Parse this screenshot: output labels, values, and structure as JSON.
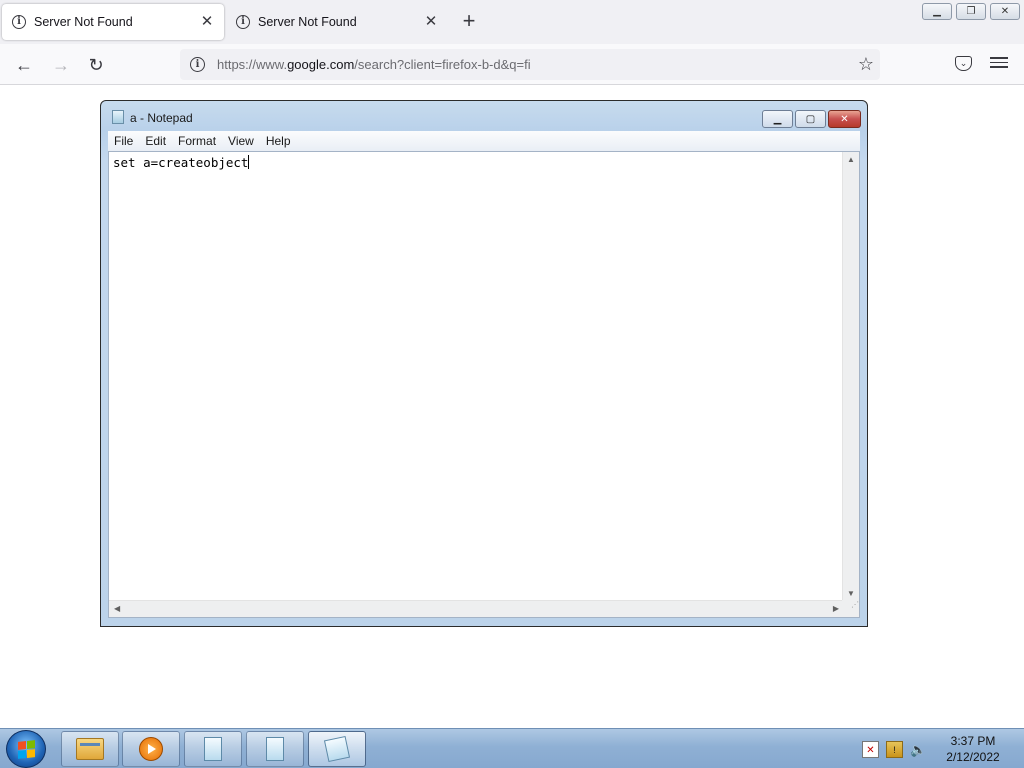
{
  "browser": {
    "tabs": [
      {
        "title": "Server Not Found",
        "active": true
      },
      {
        "title": "Server Not Found",
        "active": false
      }
    ],
    "url": {
      "prefix": "https://www.",
      "domain": "google.com",
      "suffix": "/search?client=firefox-b-d&q=fi"
    },
    "icons": [
      "info-icon",
      "back-arrow-icon",
      "forward-arrow-icon",
      "reload-icon",
      "bookmark-star-icon",
      "pocket-icon",
      "hamburger-menu-icon",
      "close-icon",
      "plus-icon"
    ]
  },
  "notepad": {
    "title": "a - Notepad",
    "menu": [
      "File",
      "Edit",
      "Format",
      "View",
      "Help"
    ],
    "content": "set a=createobject"
  },
  "taskbar": {
    "apps": [
      "windows-explorer",
      "windows-media-player",
      "notepad",
      "notepad",
      "notepad"
    ],
    "time": "3:37 PM",
    "date": "2/12/2022"
  },
  "colors": {
    "taskbar": "#8fb0d4",
    "notepad_frame": "#b9d1ea",
    "firefox_tabbar": "#f0f0f4",
    "close_button": "#c75050"
  }
}
